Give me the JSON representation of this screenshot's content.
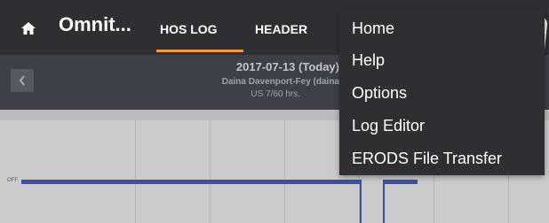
{
  "app_bar": {
    "title": "Omnit...",
    "tabs": [
      {
        "label": "HOS LOG",
        "selected": true
      },
      {
        "label": "HEADER",
        "selected": false
      }
    ],
    "accent_color": "#f29a2e"
  },
  "log_header": {
    "date": "2017-07-13 (Today)",
    "driver": "Daina Davenport-Fey (daina",
    "hours": "US 7/60 hrs."
  },
  "graph": {
    "row_label": "OFF"
  },
  "overflow_menu": {
    "items": [
      {
        "label": "Home"
      },
      {
        "label": "Help"
      },
      {
        "label": "Options"
      },
      {
        "label": "Log Editor"
      },
      {
        "label": "ERODS File Transfer"
      }
    ]
  },
  "icons": [
    "home-icon",
    "chevron-left-icon"
  ]
}
